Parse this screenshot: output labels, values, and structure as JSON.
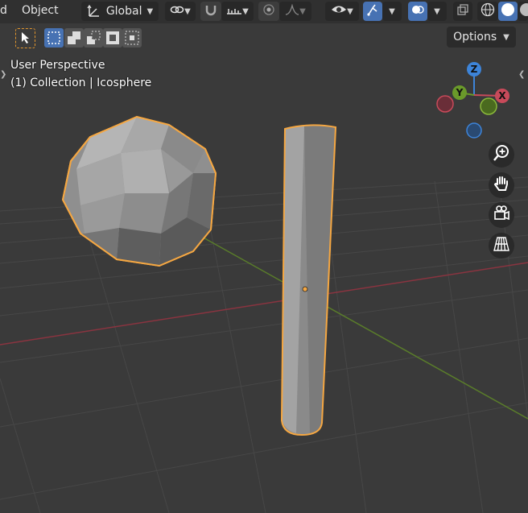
{
  "header": {
    "menu_cut": "d",
    "object_menu": "Object",
    "transform_orientation": "Global",
    "options_label": "Options"
  },
  "overlay": {
    "perspective": "User Perspective",
    "collection_info": "(1) Collection | Icosphere"
  },
  "gizmo": {
    "x": "X",
    "y": "Y",
    "z": "Z"
  },
  "colors": {
    "selection_outline": "#f5a742",
    "x_axis": "#c84a5a",
    "y_axis": "#6a9a2a",
    "z_axis": "#3d84d9",
    "active_button": "#4772b3"
  }
}
